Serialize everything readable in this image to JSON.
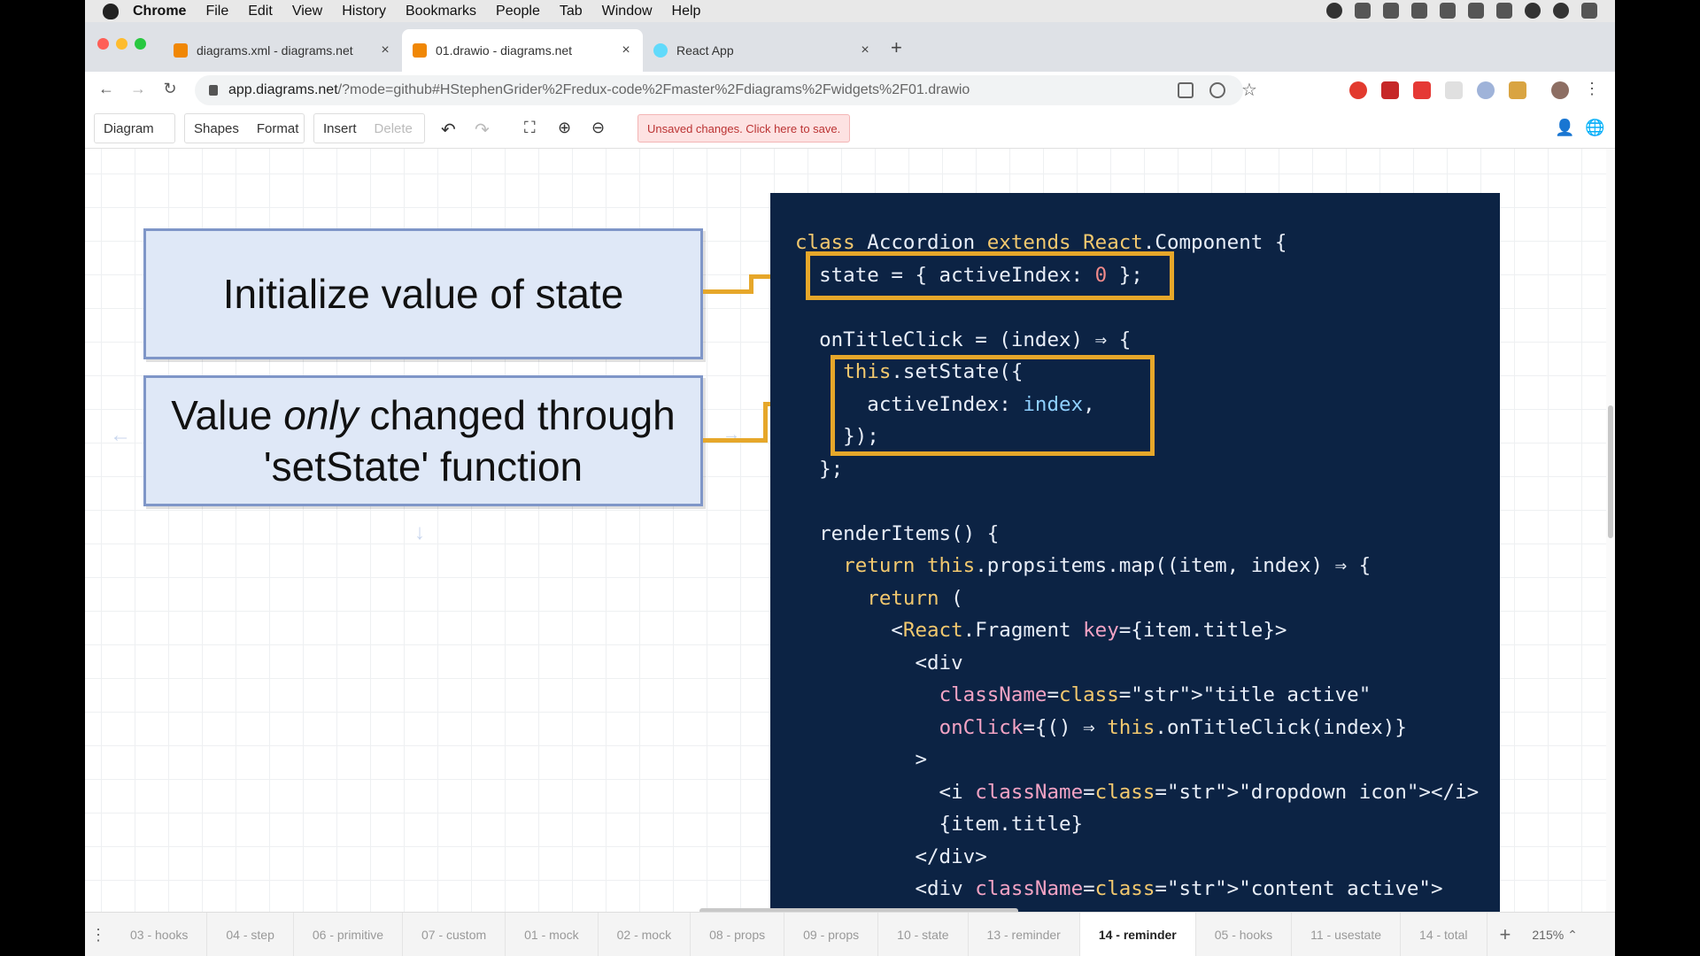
{
  "menubar": {
    "app": "Chrome",
    "items": [
      "File",
      "Edit",
      "View",
      "History",
      "Bookmarks",
      "People",
      "Tab",
      "Window",
      "Help"
    ]
  },
  "tabs": [
    {
      "title": "diagrams.xml - diagrams.net",
      "close": "×",
      "favicon_color": "#f08705"
    },
    {
      "title": "01.drawio - diagrams.net",
      "close": "×",
      "favicon_color": "#f08705"
    },
    {
      "title": "React App",
      "close": "×",
      "favicon_color": "#61dafb"
    }
  ],
  "new_tab_label": "+",
  "address": {
    "host": "app.diagrams.net",
    "path": "/?mode=github#HStephenGrider%2Fredux-code%2Fmaster%2Fdiagrams%2Fwidgets%2F01.drawio"
  },
  "toolbar": {
    "diagram": "Diagram",
    "shapes": "Shapes",
    "format": "Format",
    "insert": "Insert",
    "delete": "Delete",
    "unsaved": "Unsaved changes. Click here to save."
  },
  "diagram": {
    "box1": "Initialize value of state",
    "box2_pre": "Value ",
    "box2_em": "only",
    "box2_post": " changed through",
    "box2_line2": "'setState' function"
  },
  "code_lines": [
    "class Accordion extends React.Component {",
    "  state = { activeIndex: 0 };",
    "",
    "  onTitleClick = (index) ⇒ {",
    "    this.setState({",
    "      activeIndex: index,",
    "    });",
    "  };",
    "",
    "  renderItems() {",
    "    return this.propsitems.map((item, index) ⇒ {",
    "      return (",
    "        <React.Fragment key={item.title}>",
    "          <div",
    "            className=\"title active\"",
    "            onClick={() ⇒ this.onTitleClick(index)}",
    "          >",
    "            <i className=\"dropdown icon\"></i>",
    "            {item.title}",
    "          </div>",
    "          <div className=\"content active\">"
  ],
  "page_tabs": [
    "03 - hooks",
    "04 - step",
    "06 - primitive",
    "07 - custom",
    "01 - mock",
    "02 - mock",
    "08 - props",
    "09 - props",
    "10 - state",
    "13 - reminder",
    "14 - reminder",
    "05 - hooks",
    "11 - usestate",
    "14 - total"
  ],
  "active_page_tab": "14 - reminder",
  "zoom": "215%",
  "colors": {
    "highlight": "#e6a72a",
    "code_bg": "#0c2344",
    "box_fill": "#dfe8f7"
  }
}
